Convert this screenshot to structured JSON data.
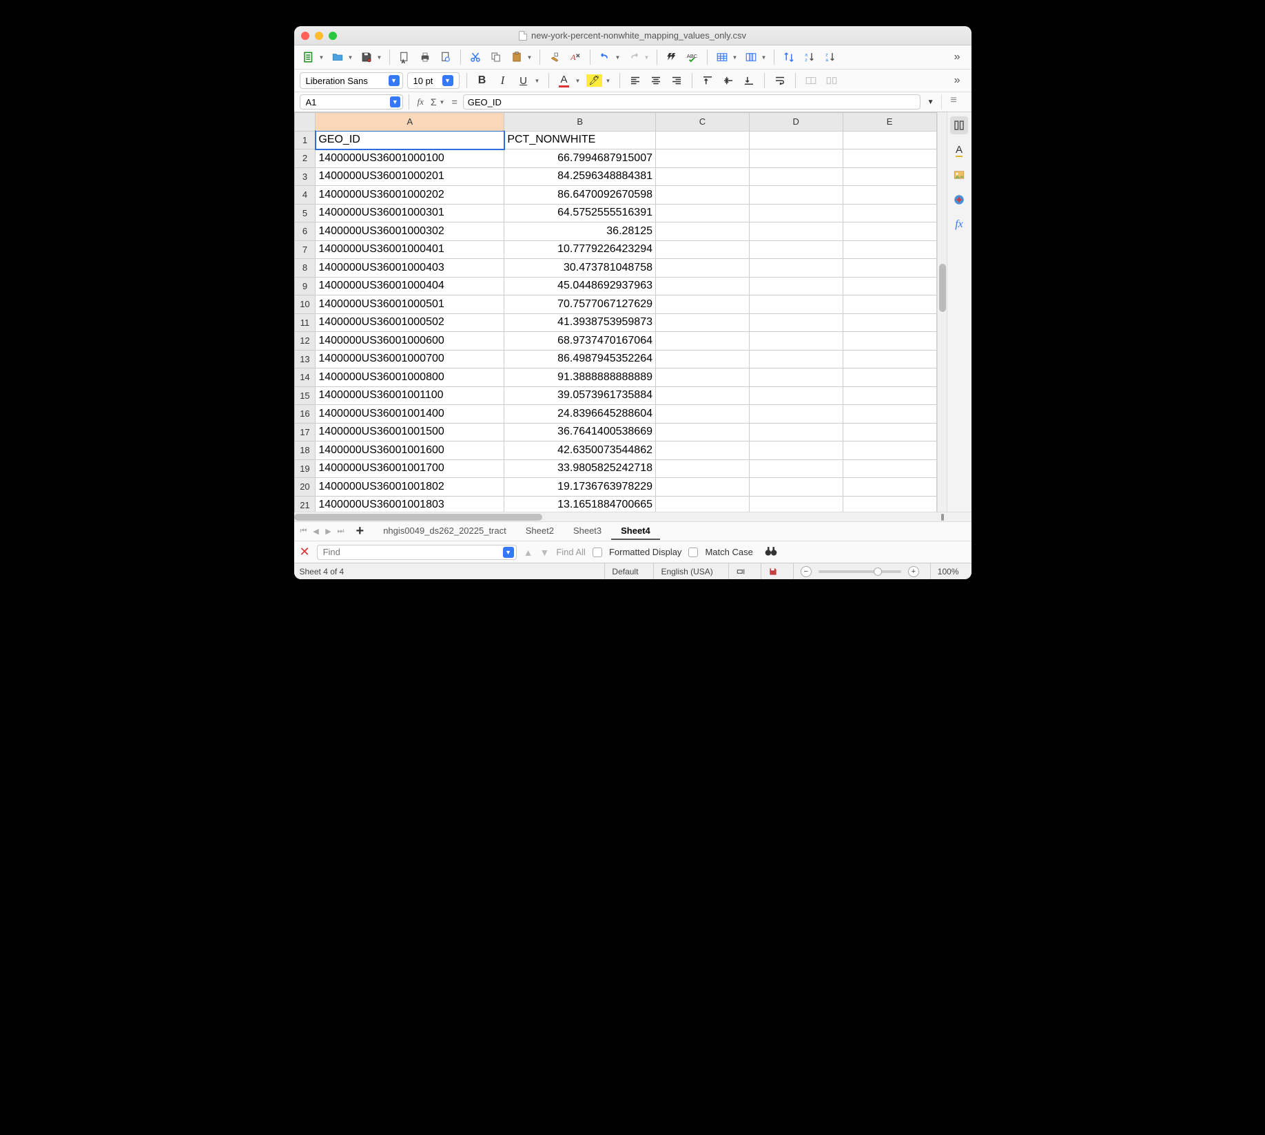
{
  "window": {
    "title": "new-york-percent-nonwhite_mapping_values_only.csv"
  },
  "format": {
    "font_name": "Liberation Sans",
    "font_size": "10 pt"
  },
  "formula_bar": {
    "cell_ref": "A1",
    "content": "GEO_ID"
  },
  "columns": [
    "A",
    "B",
    "C",
    "D",
    "E"
  ],
  "selected_column": "A",
  "selected_cell": "A1",
  "data": {
    "headers": [
      "GEO_ID",
      "PCT_NONWHITE"
    ],
    "rows": [
      [
        "1400000US36001000100",
        "66.7994687915007"
      ],
      [
        "1400000US36001000201",
        "84.2596348884381"
      ],
      [
        "1400000US36001000202",
        "86.6470092670598"
      ],
      [
        "1400000US36001000301",
        "64.5752555516391"
      ],
      [
        "1400000US36001000302",
        "36.28125"
      ],
      [
        "1400000US36001000401",
        "10.7779226423294"
      ],
      [
        "1400000US36001000403",
        "30.473781048758"
      ],
      [
        "1400000US36001000404",
        "45.0448692937963"
      ],
      [
        "1400000US36001000501",
        "70.7577067127629"
      ],
      [
        "1400000US36001000502",
        "41.3938753959873"
      ],
      [
        "1400000US36001000600",
        "68.9737470167064"
      ],
      [
        "1400000US36001000700",
        "86.4987945352264"
      ],
      [
        "1400000US36001000800",
        "91.3888888888889"
      ],
      [
        "1400000US36001001100",
        "39.0573961735884"
      ],
      [
        "1400000US36001001400",
        "24.8396645288604"
      ],
      [
        "1400000US36001001500",
        "36.7641400538669"
      ],
      [
        "1400000US36001001600",
        "42.6350073544862"
      ],
      [
        "1400000US36001001700",
        "33.9805825242718"
      ],
      [
        "1400000US36001001802",
        "19.1736763978229"
      ],
      [
        "1400000US36001001803",
        "13.1651884700665"
      ]
    ]
  },
  "tabs": {
    "items": [
      "nhgis0049_ds262_20225_tract",
      "Sheet2",
      "Sheet3",
      "Sheet4"
    ],
    "active": "Sheet4"
  },
  "find": {
    "placeholder": "Find",
    "find_all": "Find All",
    "formatted_display": "Formatted Display",
    "match_case": "Match Case"
  },
  "status": {
    "sheet_info": "Sheet 4 of 4",
    "style": "Default",
    "language": "English (USA)",
    "zoom": "100%"
  }
}
